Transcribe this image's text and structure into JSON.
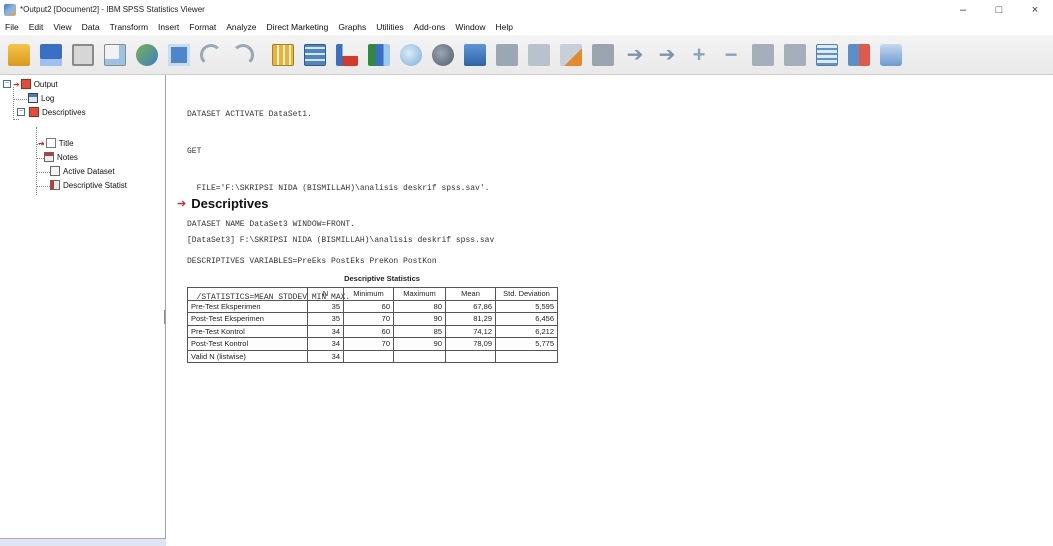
{
  "window": {
    "title": "*Output2 [Document2] - IBM SPSS Statistics Viewer",
    "controls": [
      "–",
      "□",
      "×"
    ]
  },
  "menu": [
    "File",
    "Edit",
    "View",
    "Data",
    "Transform",
    "Insert",
    "Format",
    "Analyze",
    "Direct Marketing",
    "Graphs",
    "Utilities",
    "Add-ons",
    "Window",
    "Help"
  ],
  "outline": {
    "root": "Output",
    "log": "Log",
    "descriptives": "Descriptives",
    "title": "Title",
    "notes": "Notes",
    "active_dataset": "Active Dataset",
    "descriptive_stats": "Descriptive Statist"
  },
  "syntax": [
    "DATASET ACTIVATE DataSet1.",
    "GET",
    "  FILE='F:\\SKRIPSI NIDA (BISMILLAH)\\analisis deskrif spss.sav'.",
    "DATASET NAME DataSet3 WINDOW=FRONT.",
    "DESCRIPTIVES VARIABLES=PreEks PostEks PreKon PostKon",
    "  /STATISTICS=MEAN STDDEV MIN MAX."
  ],
  "descriptives_heading": "Descriptives",
  "dataset_line": "[DataSet3] F:\\SKRIPSI NIDA (BISMILLAH)\\analisis deskrif spss.sav",
  "table": {
    "title": "Descriptive Statistics",
    "headers": [
      "",
      "N",
      "Minimum",
      "Maximum",
      "Mean",
      "Std. Deviation"
    ],
    "rows": [
      [
        "Pre-Test Eksperimen",
        "35",
        "60",
        "80",
        "67,86",
        "5,595"
      ],
      [
        "Post-Test Eksperimen",
        "35",
        "70",
        "90",
        "81,29",
        "6,456"
      ],
      [
        "Pre-Test Kontrol",
        "34",
        "60",
        "85",
        "74,12",
        "6,212"
      ],
      [
        "Post-Test Kontrol",
        "34",
        "70",
        "90",
        "78,09",
        "5,775"
      ],
      [
        "Valid N (listwise)",
        "34",
        "",
        "",
        "",
        ""
      ]
    ]
  }
}
